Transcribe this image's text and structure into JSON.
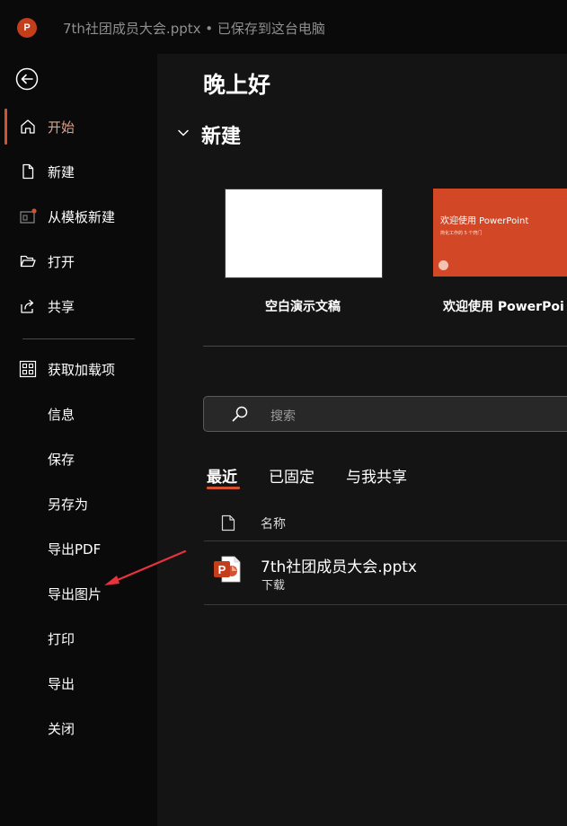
{
  "titlebar": {
    "app_letter": "P",
    "title": "7th社团成员大会.pptx • 已保存到这台电脑"
  },
  "sidebar": {
    "items": [
      {
        "label": "开始",
        "icon": "home-icon"
      },
      {
        "label": "新建",
        "icon": "new-document-icon"
      },
      {
        "label": "从模板新建",
        "icon": "template-icon"
      },
      {
        "label": "打开",
        "icon": "folder-open-icon"
      },
      {
        "label": "共享",
        "icon": "share-icon"
      },
      {
        "label": "获取加载项",
        "icon": "add-ins-icon"
      },
      {
        "label": "信息"
      },
      {
        "label": "保存"
      },
      {
        "label": "另存为"
      },
      {
        "label": "导出PDF"
      },
      {
        "label": "导出图片"
      },
      {
        "label": "打印"
      },
      {
        "label": "导出"
      },
      {
        "label": "关闭"
      }
    ],
    "active_index": 0
  },
  "main": {
    "greeting": "晚上好",
    "new_section_title": "新建",
    "templates": [
      {
        "label": "空白演示文稿"
      },
      {
        "label": "欢迎使用 PowerPoi",
        "thumb_title": "欢迎使用 PowerPoint",
        "thumb_subtitle": "简化工作的 5 个窍门"
      }
    ],
    "search": {
      "placeholder": "搜索"
    },
    "tabs": [
      {
        "label": "最近"
      },
      {
        "label": "已固定"
      },
      {
        "label": "与我共享"
      }
    ],
    "active_tab": 0,
    "file_list": {
      "column_name": "名称",
      "files": [
        {
          "name": "7th社团成员大会.pptx",
          "location": "下载"
        }
      ]
    }
  },
  "colors": {
    "accent": "#d35230",
    "brand": "#c43e1c",
    "annotation_arrow": "#e8323c"
  }
}
